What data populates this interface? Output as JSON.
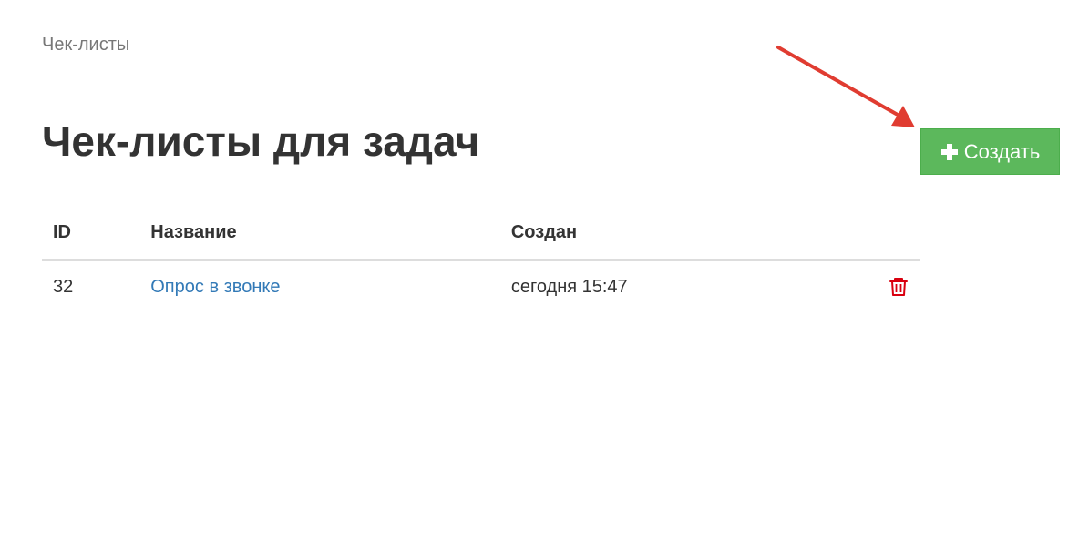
{
  "breadcrumb": "Чек-листы",
  "page_title": "Чек-листы для задач",
  "create_button": {
    "label": "Создать",
    "icon": "plus-icon",
    "color": "#5cb85c"
  },
  "table": {
    "headers": {
      "id": "ID",
      "name": "Название",
      "created": "Создан"
    },
    "rows": [
      {
        "id": "32",
        "name": "Опрос в звонке",
        "created": "сегодня 15:47",
        "action_icon": "trash-icon"
      }
    ]
  },
  "colors": {
    "link": "#337ab7",
    "delete": "#d9000f",
    "annotation_arrow": "#e03c31"
  }
}
